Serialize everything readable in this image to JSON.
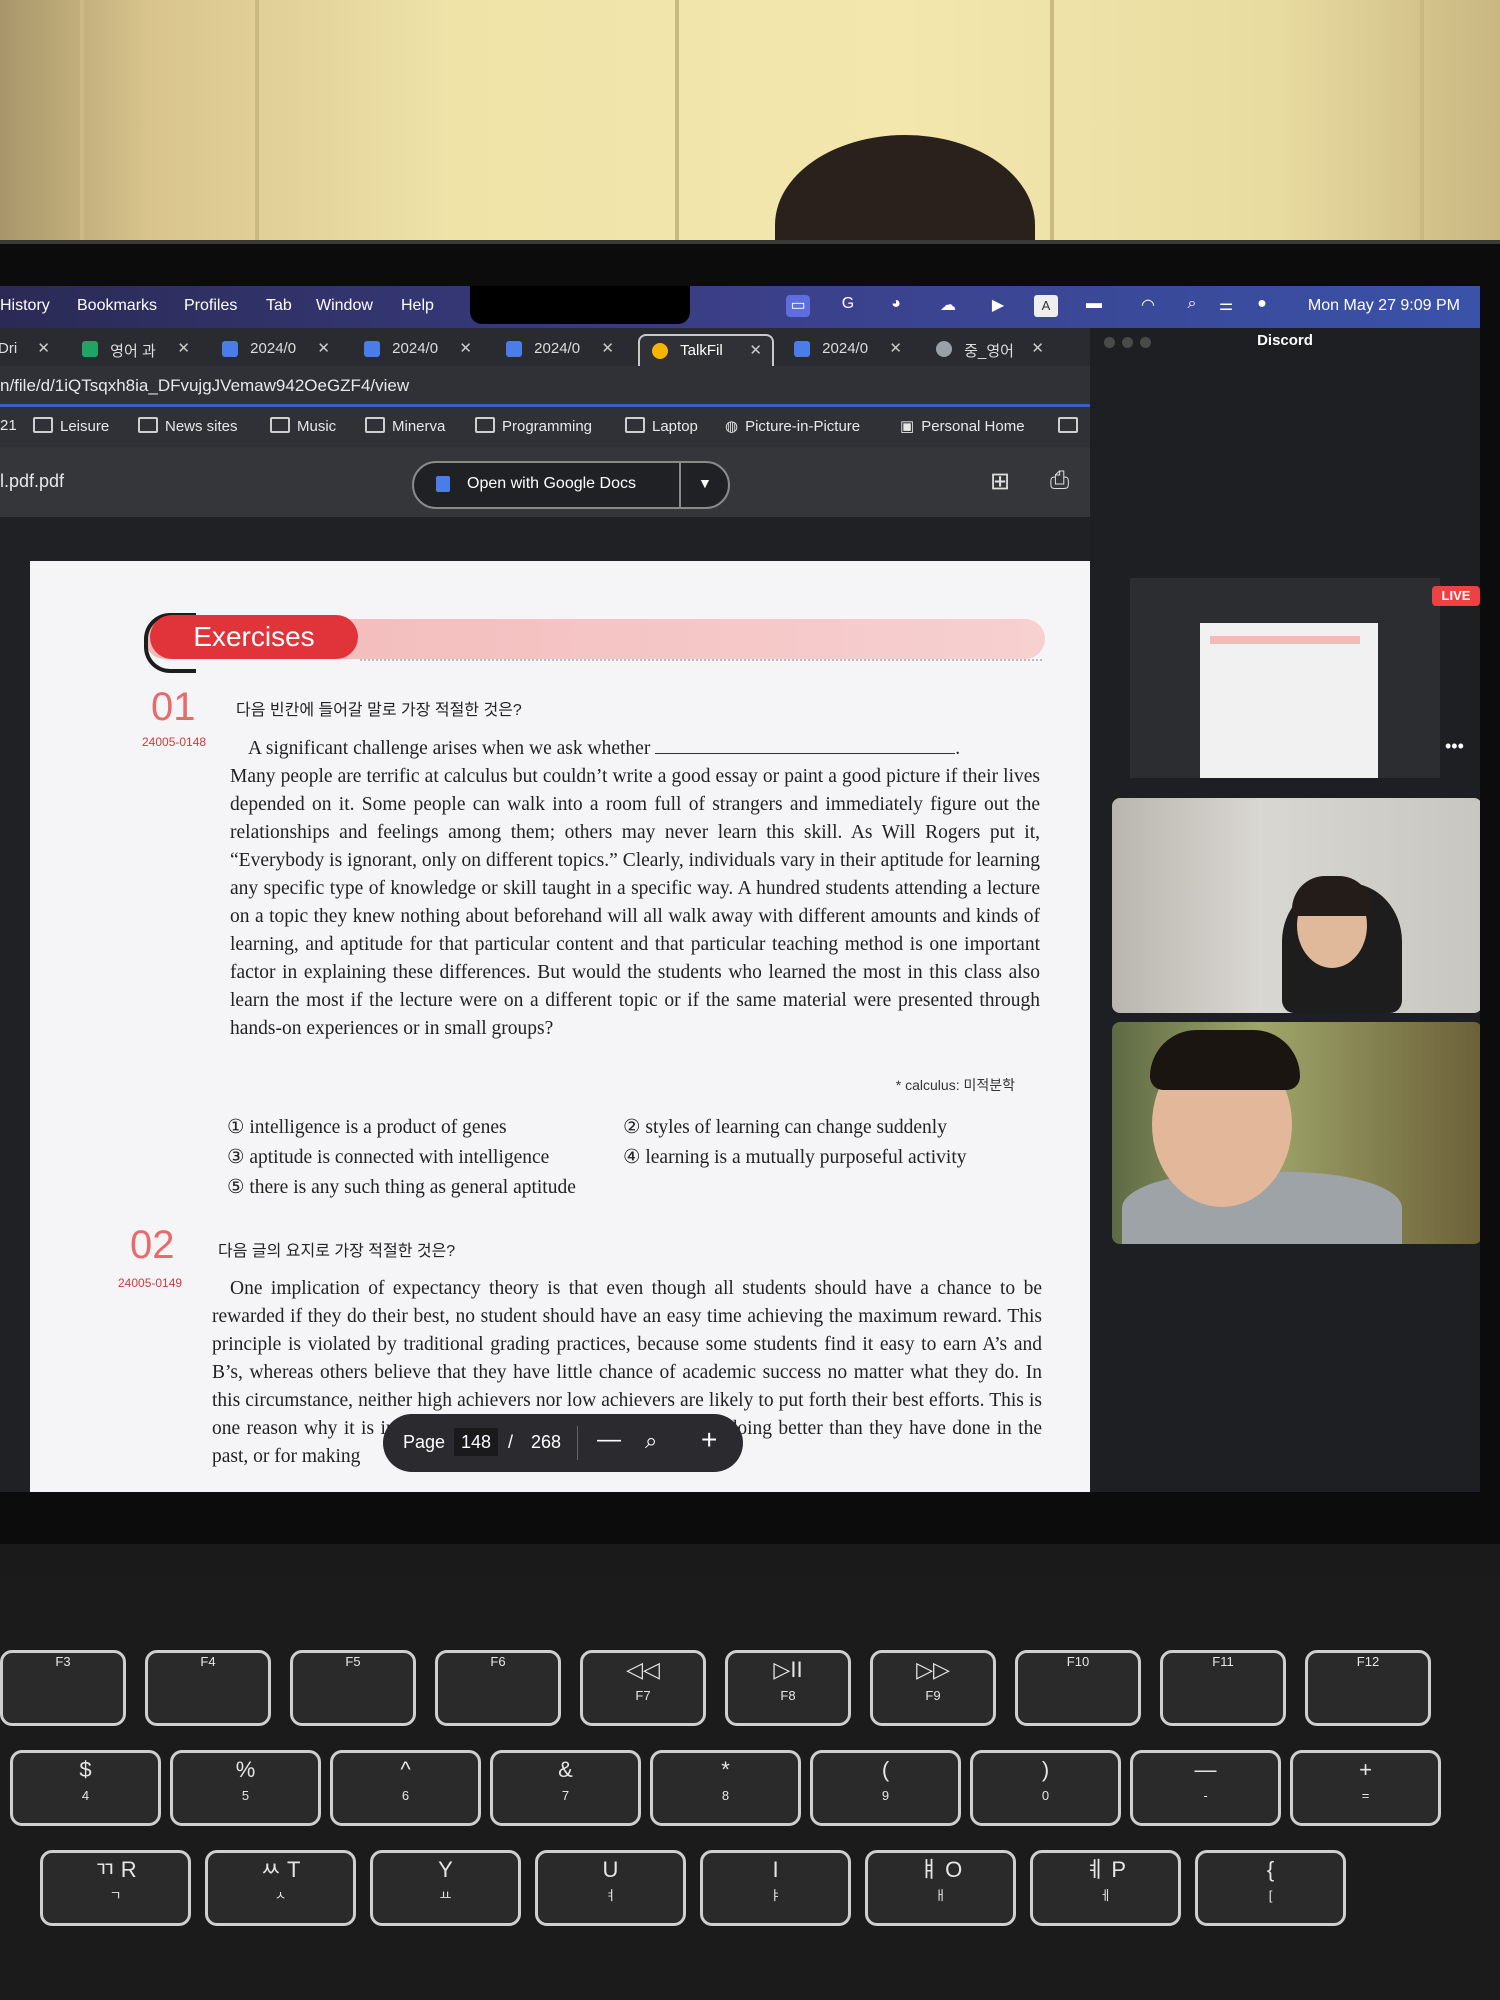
{
  "menubar": {
    "items": [
      "History",
      "Bookmarks",
      "Profiles",
      "Tab",
      "Window",
      "Help"
    ],
    "clock": "Mon May 27  9:09 PM"
  },
  "tabs": [
    {
      "label": "Dri",
      "icon": "drive-icon",
      "color": "#9aa0a6"
    },
    {
      "label": "영어 과",
      "icon": "sheets-icon",
      "color": "#1fa463"
    },
    {
      "label": "2024/0",
      "icon": "docs-icon",
      "color": "#4a7de8"
    },
    {
      "label": "2024/0",
      "icon": "docs-icon",
      "color": "#4a7de8"
    },
    {
      "label": "2024/0",
      "icon": "docs-icon",
      "color": "#4a7de8"
    },
    {
      "label": "TalkFil",
      "icon": "drive-icon",
      "color": "#f4b400",
      "active": true
    },
    {
      "label": "2024/0",
      "icon": "docs-icon",
      "color": "#4a7de8"
    },
    {
      "label": "중_영어",
      "icon": "globe-icon",
      "color": "#9aa0a6"
    }
  ],
  "url": "n/file/d/1iQTsqxh8ia_DFvujgJVemaw942OeGZF4/view",
  "bookmarks": [
    "Leisure",
    "News sites",
    "Music",
    "Minerva",
    "Programming",
    "Laptop",
    "Picture-in-Picture",
    "Personal Home"
  ],
  "bookmarks_prefix": "21",
  "viewer": {
    "filename": "l.pdf.pdf",
    "open_with": "Open with Google Docs"
  },
  "exercise": {
    "heading": "Exercises",
    "q1": {
      "number": "01",
      "code": "24005-0148",
      "title": "다음 빈칸에 들어갈 말로 가장 적절한 것은?",
      "first_line": "A significant challenge arises when we ask whether",
      "body": "Many people are terrific at calculus but couldn’t write a good essay or paint a good picture if their lives depended on it. Some people can walk into a room full of strangers and immediately figure out the relationships and feelings among them; others may never learn this skill. As Will Rogers put it, “Everybody is ignorant, only on different topics.” Clearly, individuals vary in their aptitude for learning any specific type of knowledge or skill taught in a specific way. A hundred students attending a lecture on a topic they knew nothing about beforehand will all walk away with different amounts and kinds of learning, and aptitude for that particular content and that particular teaching method is one important factor in explaining these differences. But would the students who learned the most in this class also learn the most if the lecture were on a different topic or if the same material were presented through hands-on experiences or in small groups?",
      "footnote": "* calculus: 미적분학",
      "options": [
        "① intelligence is a product of genes",
        "② styles of learning can change suddenly",
        "③ aptitude is connected with intelligence",
        "④ learning is a mutually purposeful activity",
        "⑤ there is any such thing as general aptitude"
      ]
    },
    "q2": {
      "number": "02",
      "code": "24005-0149",
      "title": "다음 글의 요지로 가장 적절한 것은?",
      "body": "One implication of expectancy theory is that even though all students should have a chance to be rewarded if they do their best, no student should have an easy time achieving the maximum reward. This principle is violated by traditional grading practices, because some students find it easy to earn A’s and B’s, whereas others believe that they have little chance of academic success no matter what they do. In this circumstance, neither high achievers nor low achievers are likely to put forth their best efforts. This is one reason why it is important to reward students for effort, for doing better than they have done in the past, or for making"
    }
  },
  "pagebar": {
    "label": "Page",
    "current": "148",
    "separator": "/",
    "total": "268"
  },
  "discord": {
    "title": "Discord",
    "live": "LIVE",
    "more": "•••"
  },
  "keyboard": {
    "row1": [
      {
        "top": "",
        "bottom": "F3"
      },
      {
        "top": "",
        "bottom": "F4"
      },
      {
        "top": "",
        "bottom": "F5"
      },
      {
        "top": "",
        "bottom": "F6"
      },
      {
        "top": "◁◁",
        "bottom": "F7"
      },
      {
        "top": "▷II",
        "bottom": "F8"
      },
      {
        "top": "▷▷",
        "bottom": "F9"
      },
      {
        "top": "",
        "bottom": "F10"
      },
      {
        "top": "",
        "bottom": "F11"
      },
      {
        "top": "",
        "bottom": "F12"
      }
    ],
    "row2": [
      {
        "top": "$",
        "bottom": "4"
      },
      {
        "top": "%",
        "bottom": "5"
      },
      {
        "top": "^",
        "bottom": "6"
      },
      {
        "top": "&",
        "bottom": "7"
      },
      {
        "top": "*",
        "bottom": "8"
      },
      {
        "top": "(",
        "bottom": "9"
      },
      {
        "top": ")",
        "bottom": "0"
      },
      {
        "top": "—",
        "bottom": "-"
      },
      {
        "top": "+",
        "bottom": "="
      }
    ],
    "row3": [
      {
        "top": "ㄲ R",
        "bottom": "ㄱ"
      },
      {
        "top": "ㅆ T",
        "bottom": "ㅅ"
      },
      {
        "top": "Y",
        "bottom": "ㅛ"
      },
      {
        "top": "U",
        "bottom": "ㅕ"
      },
      {
        "top": "I",
        "bottom": "ㅑ"
      },
      {
        "top": "ㅒ O",
        "bottom": "ㅐ"
      },
      {
        "top": "ㅖ P",
        "bottom": "ㅔ"
      },
      {
        "top": "{",
        "bottom": "["
      }
    ]
  }
}
